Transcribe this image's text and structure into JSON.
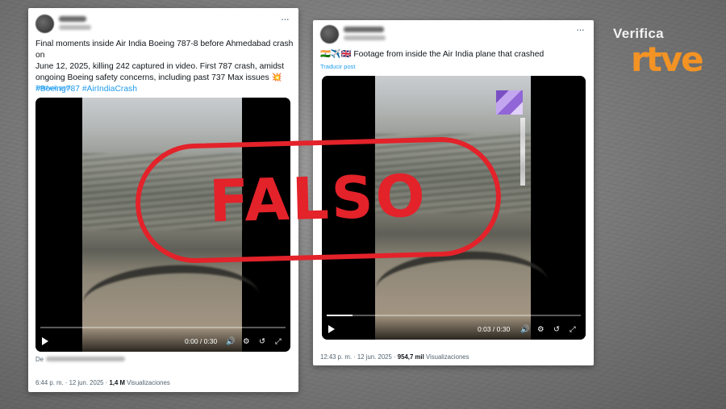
{
  "brand": {
    "verifica": "Verifica",
    "rtve": "rtve"
  },
  "stamp": {
    "label": "FALSO"
  },
  "post1": {
    "text_lines": [
      "Final moments inside Air India Boeing 787-8 before Ahmedabad crash on",
      "June 12, 2025, killing 242 captured in video. First 787 crash, amidst",
      "ongoing Boeing safety concerns, including past 737 Max issues 💥"
    ],
    "hashtags": "#Boeing787 #AirIndiaCrash",
    "translate": "Traducir post",
    "video": {
      "time": "0:00 / 0:30",
      "progress": 0.0
    },
    "from_prefix": "De",
    "time_posted": "6:44 p. m. · 12 jun. 2025 ·",
    "views_count": "1,4 M",
    "views_label": "Visualizaciones"
  },
  "post2": {
    "flags": "🇮🇳✈️🇬🇧",
    "text": "Footage from inside the Air India plane that crashed",
    "translate": "Traducir post",
    "video": {
      "time": "0:03 / 0:30",
      "progress": 0.1
    },
    "time_posted": "12:43 p. m. · 12 jun. 2025 ·",
    "views_count": "954,7 mil",
    "views_label": "Visualizaciones"
  },
  "icons": {
    "more": "more-icon",
    "play": "play-icon",
    "volume": "volume-icon",
    "settings": "settings-icon",
    "replay": "replay-icon",
    "fullscreen": "fullscreen-icon"
  },
  "colors": {
    "stamp": "#e3222a",
    "rtve_orange": "#f39324",
    "link": "#1d9bf0"
  }
}
